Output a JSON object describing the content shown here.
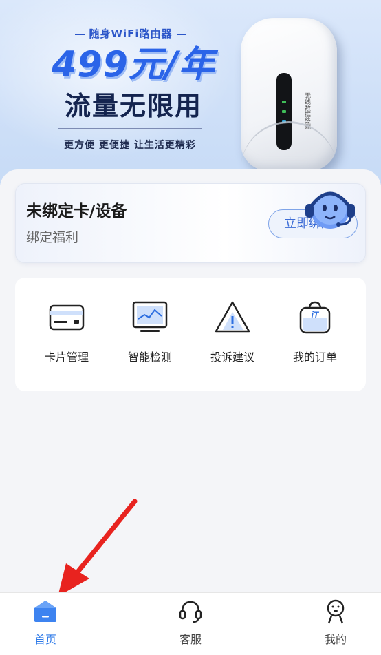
{
  "banner": {
    "sub_title": "随身WiFi路由器",
    "price": "499元/年",
    "headline": "流量无限用",
    "slogan": "更方便 更便捷 让生活更精彩",
    "device_brand": "无线数据终端"
  },
  "bind_card": {
    "title": "未绑定卡/设备",
    "subtitle": "绑定福利",
    "button_label": "立即绑定"
  },
  "features": [
    {
      "label": "卡片管理",
      "icon": "card-icon"
    },
    {
      "label": "智能检测",
      "icon": "monitor-chart-icon"
    },
    {
      "label": "投诉建议",
      "icon": "warning-icon"
    },
    {
      "label": "我的订单",
      "icon": "shopping-bag-icon"
    }
  ],
  "bottom_nav": [
    {
      "label": "首页",
      "icon": "home-icon",
      "active": true
    },
    {
      "label": "客服",
      "icon": "headset-icon",
      "active": false
    },
    {
      "label": "我的",
      "icon": "profile-icon",
      "active": false
    }
  ],
  "colors": {
    "accent": "#2e7ae8",
    "price_blue": "#2b64e8",
    "annotation_red": "#e8231f"
  }
}
